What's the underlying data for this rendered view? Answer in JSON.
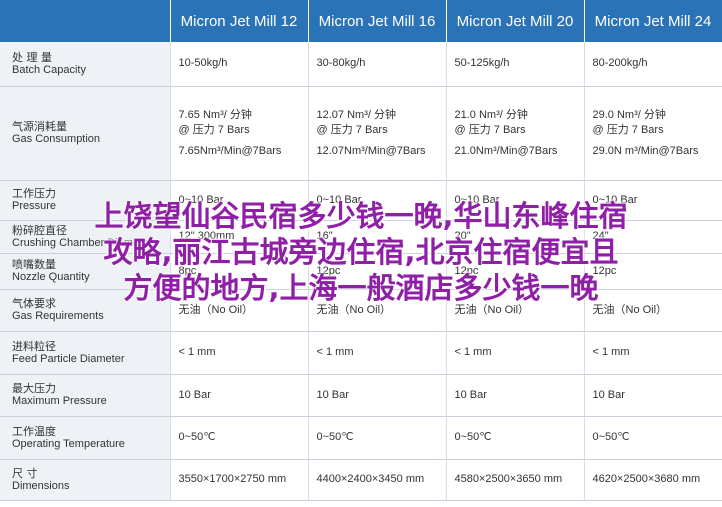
{
  "models": [
    "Micron Jet Mill 12",
    "Micron Jet Mill 16",
    "Micron Jet Mill 20",
    "Micron Jet Mill 24"
  ],
  "rows": [
    {
      "zh": "处 理 量",
      "en": "Batch Capacity",
      "values": [
        [
          "10-50kg/h"
        ],
        [
          "30-80kg/h"
        ],
        [
          "50-125kg/h"
        ],
        [
          "80-200kg/h"
        ]
      ]
    },
    {
      "zh": "气源消耗量",
      "en": "Gas Consumption",
      "values": [
        [
          "7.65 Nm³/ 分钟",
          "@ 压力 7 Bars",
          "7.65Nm³/Min@7Bars"
        ],
        [
          "12.07 Nm³/ 分钟",
          "@ 压力 7 Bars",
          "12.07Nm³/Min@7Bars"
        ],
        [
          "21.0 Nm³/ 分钟",
          "@ 压力 7 Bars",
          "21.0Nm³/Min@7Bars"
        ],
        [
          "29.0 Nm³/ 分钟",
          "@ 压力 7 Bars",
          "29.0N m³/Min@7Bars"
        ]
      ]
    },
    {
      "zh": "工作压力",
      "en": "Pressure",
      "values": [
        [
          "0~10 Bar"
        ],
        [
          "0~10 Bar"
        ],
        [
          "0~10 Bar"
        ],
        [
          "0~10 Bar"
        ]
      ]
    },
    {
      "zh": "粉碎腔直径",
      "en": "Crushing Chamber Diameter",
      "values": [
        [
          "12\"  300mm"
        ],
        [
          "16\""
        ],
        [
          "20\""
        ],
        [
          "24\""
        ]
      ]
    },
    {
      "zh": "喷嘴数量",
      "en": "Nozzle Quantity",
      "values": [
        [
          "8pc"
        ],
        [
          "12pc"
        ],
        [
          "12pc"
        ],
        [
          "12pc"
        ]
      ]
    },
    {
      "zh": "气体要求",
      "en": "Gas Requirements",
      "values": [
        [
          "无油（No Oil）"
        ],
        [
          "无油（No Oil）"
        ],
        [
          "无油（No Oil）"
        ],
        [
          "无油（No Oil）"
        ]
      ]
    },
    {
      "zh": "进料粒径",
      "en": "Feed Particle Diameter",
      "values": [
        [
          "< 1 mm"
        ],
        [
          "< 1 mm"
        ],
        [
          "< 1 mm"
        ],
        [
          "< 1 mm"
        ]
      ]
    },
    {
      "zh": "最大压力",
      "en": "Maximum Pressure",
      "values": [
        [
          "10 Bar"
        ],
        [
          "10 Bar"
        ],
        [
          "10 Bar"
        ],
        [
          "10 Bar"
        ]
      ]
    },
    {
      "zh": "工作温度",
      "en": "Operating Temperature",
      "values": [
        [
          "0~50℃"
        ],
        [
          "0~50℃"
        ],
        [
          "0~50℃"
        ],
        [
          "0~50℃"
        ]
      ]
    },
    {
      "zh": "尺    寸",
      "en": "Dimensions",
      "values": [
        [
          "3550×1700×2750 mm"
        ],
        [
          "4400×2400×3450 mm"
        ],
        [
          "4580×2500×3650 mm"
        ],
        [
          "4620×2500×3680 mm"
        ]
      ]
    }
  ],
  "overlay_lines": [
    "上饶望仙谷民宿多少钱一晚,华山东峰住宿",
    "攻略,丽江古城旁边住宿,北京住宿便宜且",
    "方便的地方,上海一般酒店多少钱一晚"
  ]
}
